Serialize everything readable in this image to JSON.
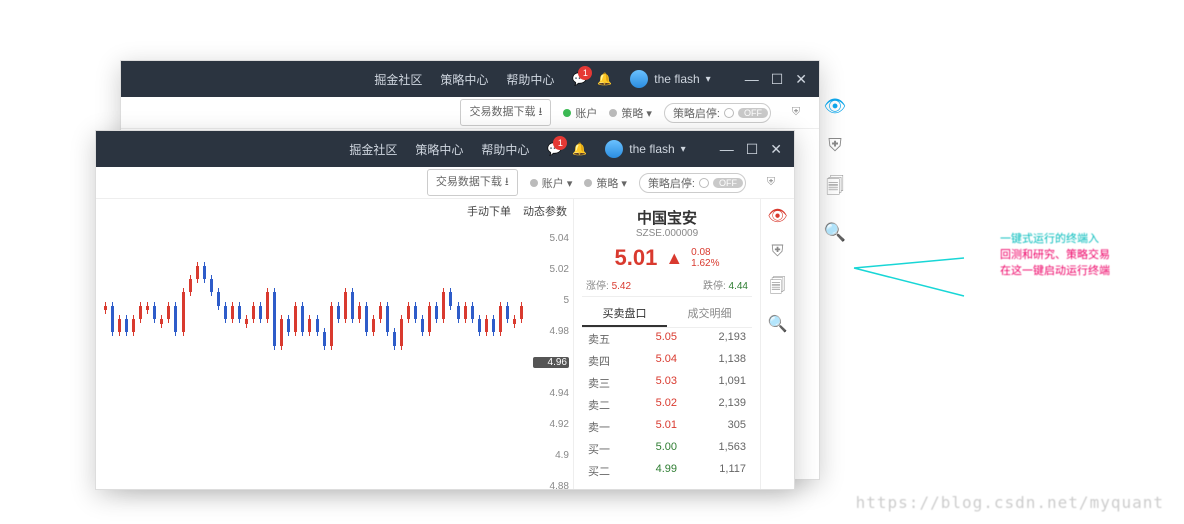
{
  "header": {
    "nav": [
      "掘金社区",
      "策略中心",
      "帮助中心"
    ],
    "notif_count": "1",
    "username": "the flash"
  },
  "toolbar": {
    "download": "交易数据下载",
    "account": "账户",
    "strategy": "策略",
    "pause_label": "策略启停:",
    "off": "OFF"
  },
  "chart_tabs": {
    "manual": "手动下单",
    "params": "动态参数"
  },
  "stock": {
    "name": "中国宝安",
    "code": "SZSE.000009",
    "price": "5.01",
    "chg_abs": "0.08",
    "chg_pct": "1.62%",
    "limit_up_label": "涨停:",
    "limit_up": "5.42",
    "limit_dn_label": "跌停:",
    "limit_dn": "4.44"
  },
  "book_tabs": {
    "depth": "买卖盘口",
    "ticks": "成交明细"
  },
  "order_book": [
    {
      "lbl": "卖五",
      "p": "5.05",
      "q": "2,193",
      "side": "sell"
    },
    {
      "lbl": "卖四",
      "p": "5.04",
      "q": "1,138",
      "side": "sell"
    },
    {
      "lbl": "卖三",
      "p": "5.03",
      "q": "1,091",
      "side": "sell"
    },
    {
      "lbl": "卖二",
      "p": "5.02",
      "q": "2,139",
      "side": "sell"
    },
    {
      "lbl": "卖一",
      "p": "5.01",
      "q": "305",
      "side": "sell"
    },
    {
      "lbl": "买一",
      "p": "5.00",
      "q": "1,563",
      "side": "buy"
    },
    {
      "lbl": "买二",
      "p": "4.99",
      "q": "1,117",
      "side": "buy"
    }
  ],
  "y_ticks": [
    "5.04",
    "5.02",
    "5",
    "4.98",
    "4.96",
    "4.94",
    "4.92",
    "4.9",
    "4.88"
  ],
  "y_hl": 4,
  "annotation": {
    "l1": "一键式运行的终端入",
    "l2": "回测和研究、策略交易",
    "l3": "在这一键启动运行终端"
  },
  "watermark": "https://blog.csdn.net/myquant",
  "chart_data": {
    "type": "bar",
    "title": "",
    "xlabel": "",
    "ylabel": "",
    "ylim": [
      4.88,
      5.06
    ],
    "note": "K-line candlestick; approximate OHLC estimated from pixels (~60 bars)",
    "series": [
      {
        "name": "close_approx",
        "values": [
          5.01,
          4.99,
          5.0,
          4.99,
          5.0,
          5.01,
          5.01,
          5.0,
          5.0,
          5.01,
          4.99,
          5.02,
          5.03,
          5.04,
          5.03,
          5.02,
          5.01,
          5.0,
          5.01,
          5.0,
          5.0,
          5.01,
          5.0,
          5.02,
          4.98,
          5.0,
          4.99,
          5.01,
          4.99,
          5.0,
          4.99,
          4.98,
          5.01,
          5.0,
          5.02,
          5.0,
          5.01,
          4.99,
          5.0,
          5.01,
          4.99,
          4.98,
          5.0,
          5.01,
          5.0,
          4.99,
          5.01,
          5.0,
          5.02,
          5.01,
          5.0,
          5.01,
          5.0,
          4.99,
          5.0,
          4.99,
          5.01,
          5.0,
          5.0,
          5.01
        ]
      }
    ]
  }
}
